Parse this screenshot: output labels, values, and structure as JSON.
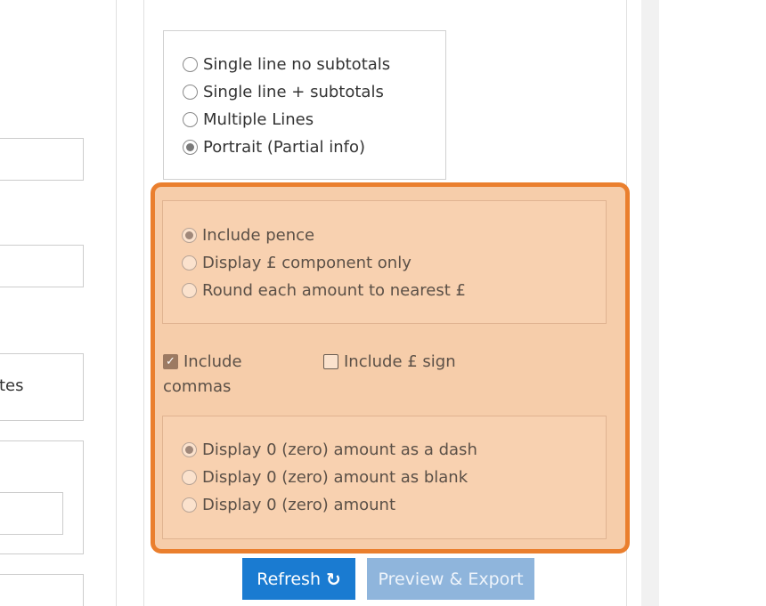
{
  "left_panel": {
    "fragment_text": "tes"
  },
  "layout_options": {
    "items": [
      {
        "label": "Single line no subtotals",
        "checked": false
      },
      {
        "label": "Single line + subtotals",
        "checked": false
      },
      {
        "label": "Multiple Lines",
        "checked": false
      },
      {
        "label": "Portrait (Partial info)",
        "checked": true
      }
    ]
  },
  "pence_options": {
    "items": [
      {
        "label": "Include pence",
        "checked": true
      },
      {
        "label": "Display £ component only",
        "checked": false
      },
      {
        "label": "Round each amount to nearest £",
        "checked": false
      }
    ]
  },
  "checkboxes": {
    "include_commas_line1": "Include",
    "include_commas_line2": "commas",
    "include_commas_checked": true,
    "include_pound_sign": "Include £ sign",
    "include_pound_sign_checked": false
  },
  "zero_options": {
    "items": [
      {
        "label": "Display 0 (zero) amount as a dash",
        "checked": true
      },
      {
        "label": "Display 0 (zero) amount as blank",
        "checked": false
      },
      {
        "label": "Display 0 (zero) amount",
        "checked": false
      }
    ]
  },
  "buttons": {
    "refresh_label": "Refresh",
    "refresh_icon": "↻",
    "preview_label": "Preview & Export"
  },
  "colors": {
    "highlight_border": "#ea7f2e",
    "highlight_fill": "#f6cdaa",
    "refresh_button": "#1a7bd1",
    "preview_button": "#8fb5dc"
  }
}
